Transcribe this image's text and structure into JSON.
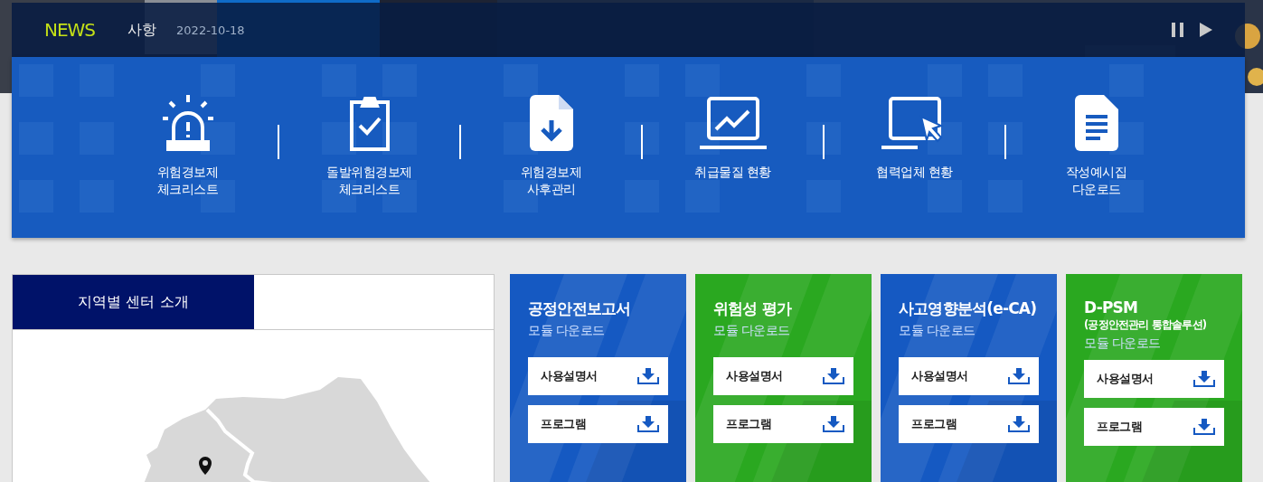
{
  "news": {
    "label": "NEWS",
    "title": "사항",
    "date": "2022-10-18",
    "controls": [
      {
        "kind": "pause"
      },
      {
        "kind": "play"
      }
    ]
  },
  "quick_menu": [
    {
      "kind": "alarm",
      "lines": [
        "위험경보제",
        "체크리스트"
      ]
    },
    {
      "kind": "clipboard",
      "lines": [
        "돌발위험경보제",
        "체크리스트"
      ]
    },
    {
      "kind": "document",
      "lines": [
        "위험경보제",
        "사후관리"
      ]
    },
    {
      "kind": "chart",
      "lines": [
        "취급물질 현황"
      ]
    },
    {
      "kind": "cursor",
      "lines": [
        "협력업체 현황"
      ]
    },
    {
      "kind": "paper",
      "lines": [
        "작성예시집",
        "다운로드"
      ]
    }
  ],
  "region": {
    "tabs": [
      {
        "label": "지역별 센터 소개",
        "selected": true
      }
    ]
  },
  "modules": [
    {
      "title": "공정안전보고서",
      "caption": "모듈 다운로드",
      "color": "#1559c2",
      "buttons": [
        "사용설명서",
        "프로그램"
      ]
    },
    {
      "title": "위험성 평가",
      "caption": "모듈 다운로드",
      "color": "#2aa820",
      "buttons": [
        "사용설명서",
        "프로그램"
      ]
    },
    {
      "title": "사고영향분석(e-CA)",
      "caption": "모듈 다운로드",
      "color": "#1559c2",
      "buttons": [
        "사용설명서",
        "프로그램"
      ]
    },
    {
      "title": "D-PSM",
      "subtitle": "(공정안전관리 통합솔루션)",
      "caption": "모듈 다운로드",
      "color": "#2aa820",
      "buttons": [
        "사용설명서",
        "프로그램"
      ]
    }
  ]
}
